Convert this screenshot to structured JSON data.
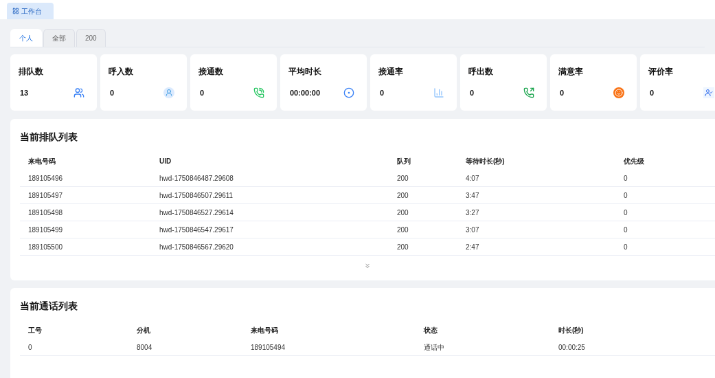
{
  "page_tab": {
    "label": "工作台"
  },
  "tabs": [
    {
      "label": "个人",
      "selected": true
    },
    {
      "label": "全部",
      "selected": false
    },
    {
      "label": "200",
      "selected": false
    }
  ],
  "stats": [
    {
      "title": "排队数",
      "value": "13"
    },
    {
      "title": "呼入数",
      "value": "0"
    },
    {
      "title": "接通数",
      "value": "0"
    },
    {
      "title": "平均时长",
      "value": "00:00:00"
    },
    {
      "title": "接通率",
      "value": "0"
    },
    {
      "title": "呼出数",
      "value": "0"
    },
    {
      "title": "满意率",
      "value": "0"
    },
    {
      "title": "评价率",
      "value": "0"
    }
  ],
  "queue_table": {
    "title": "当前排队列表",
    "columns": [
      "来电号码",
      "UID",
      "队列",
      "等待时长(秒)",
      "优先级"
    ],
    "rows": [
      [
        "189105496",
        "hwd-1750846487.29608",
        "200",
        "4:07",
        "0"
      ],
      [
        "189105497",
        "hwd-1750846507.29611",
        "200",
        "3:47",
        "0"
      ],
      [
        "189105498",
        "hwd-1750846527.29614",
        "200",
        "3:27",
        "0"
      ],
      [
        "189105499",
        "hwd-1750846547.29617",
        "200",
        "3:07",
        "0"
      ],
      [
        "189105500",
        "hwd-1750846567.29620",
        "200",
        "2:47",
        "0"
      ]
    ]
  },
  "call_table": {
    "title": "当前通话列表",
    "columns": [
      "工号",
      "分机",
      "来电号码",
      "状态",
      "时长(秒)"
    ],
    "rows": [
      [
        "0",
        "8004",
        "189105494",
        "通话中",
        "00:00:25"
      ]
    ]
  }
}
